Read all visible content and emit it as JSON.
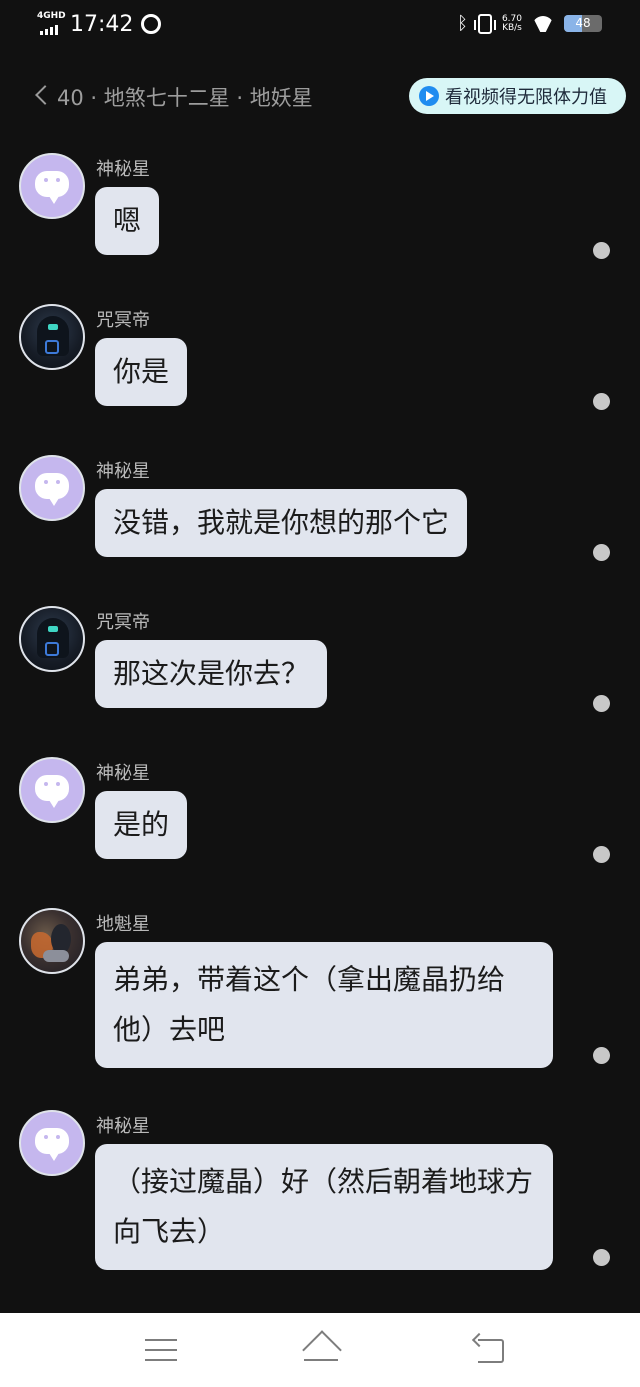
{
  "status_bar": {
    "network": "4GHD",
    "time": "17:42",
    "speed_value": "6.70",
    "speed_unit": "KB/s",
    "battery": "48"
  },
  "header": {
    "title": "40 · 地煞七十二星 · 地妖星",
    "video_button": "看视频得无限体力值"
  },
  "messages": [
    {
      "sender": "神秘星",
      "avatar": "mystery-bubble-avatar",
      "text": "嗯"
    },
    {
      "sender": "咒冥帝",
      "avatar": "hooded-figure-avatar",
      "text": "你是"
    },
    {
      "sender": "神秘星",
      "avatar": "mystery-bubble-avatar",
      "text": "没错，我就是你想的那个它"
    },
    {
      "sender": "咒冥帝",
      "avatar": "hooded-figure-avatar",
      "text": "那这次是你去？"
    },
    {
      "sender": "神秘星",
      "avatar": "mystery-bubble-avatar",
      "text": "是的"
    },
    {
      "sender": "地魁星",
      "avatar": "illustrated-character-avatar",
      "text": "弟弟，带着这个（拿出魔晶扔给他）去吧"
    },
    {
      "sender": "神秘星",
      "avatar": "mystery-bubble-avatar",
      "text": "（接过魔晶）好（然后朝着地球方向飞去）"
    }
  ],
  "colors": {
    "background": "#111111",
    "bubble": "#e1e5ee",
    "mystery_avatar": "#c5b7ee",
    "video_pill": "#d8f6f6",
    "play_icon": "#1f8cf0"
  }
}
